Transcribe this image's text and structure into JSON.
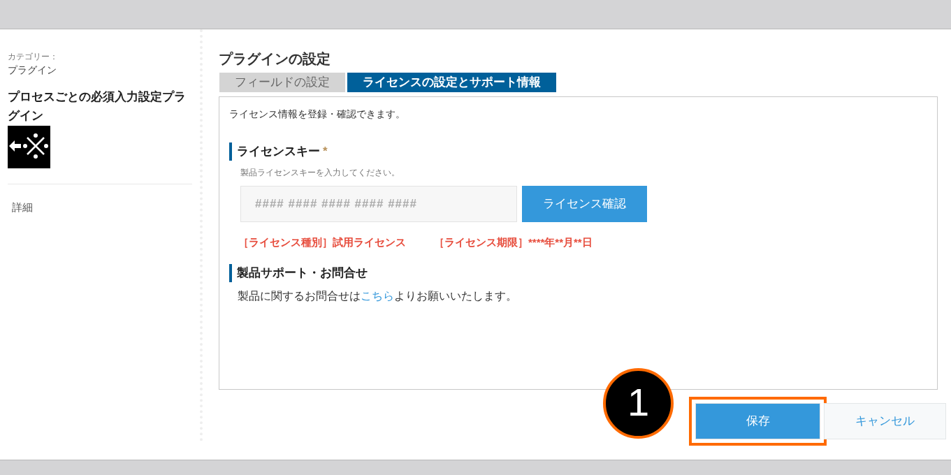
{
  "sidebar": {
    "category_label": "カテゴリー：",
    "category": "プラグイン",
    "plugin_name": "プロセスごとの必須入力設定プラグイン",
    "items": [
      {
        "label": "詳細"
      }
    ]
  },
  "page_title": "プラグインの設定",
  "tabs": [
    {
      "label": "フィールドの設定",
      "selected": false
    },
    {
      "label": "ライセンスの設定とサポート情報",
      "selected": true
    }
  ],
  "intro": "ライセンス情報を登録・確認できます。",
  "license_section": {
    "heading": "ライセンスキー",
    "required_mark": "*",
    "hint": "製品ライセンスキーを入力してください。",
    "placeholder": "#### #### #### #### ####",
    "check_button": "ライセンス確認",
    "info": [
      "［ライセンス種別］試用ライセンス",
      "［ライセンス期限］****年**月**日"
    ]
  },
  "support_section": {
    "heading": "製品サポート・お問合せ",
    "text_before": "製品に関するお問合せは",
    "link": "こちら",
    "text_after": "よりお願いいたします。"
  },
  "buttons": [
    {
      "label": "保存",
      "kind": "primary",
      "highlighted": true
    },
    {
      "label": "キャンセル",
      "kind": "secondary",
      "highlighted": false
    }
  ],
  "callout": {
    "number": "1"
  }
}
